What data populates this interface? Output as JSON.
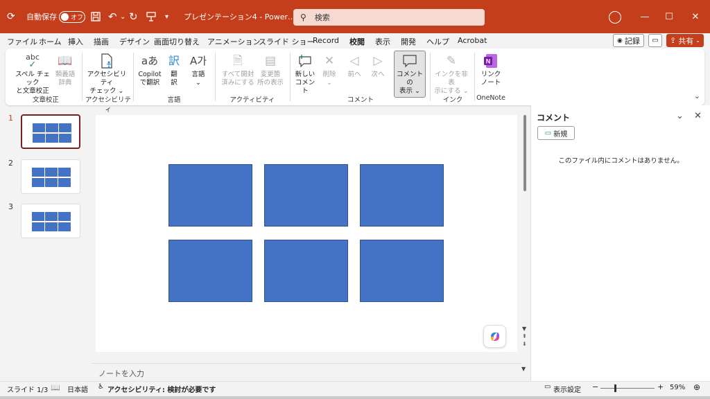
{
  "colors": {
    "brand": "#c43e1c",
    "shape_fill": "#4472c4",
    "shape_border": "#2f528f"
  },
  "titlebar": {
    "autosave_label": "自動保存",
    "autosave_state": "オフ",
    "doc_title": "プレゼンテーション4 - Power…",
    "search_placeholder": "検索",
    "icons": [
      "app-icon",
      "save-icon",
      "undo-icon",
      "redo-icon",
      "presenter-icon",
      "customize-icon",
      "user-icon"
    ],
    "window_controls": [
      "minimize",
      "maximize",
      "close"
    ]
  },
  "menu": {
    "tabs": [
      "ファイル",
      "ホーム",
      "挿入",
      "描画",
      "デザイン",
      "画面切り替え",
      "アニメーション",
      "スライド ショー",
      "Record",
      "校閲",
      "表示",
      "開発",
      "ヘルプ",
      "Acrobat"
    ],
    "active_tab": "校閲",
    "record_label": "記録",
    "share_label": "共有"
  },
  "ribbon": {
    "groups": [
      {
        "label": "文章校正",
        "buttons": [
          {
            "line1": "スペル チェック",
            "line2": "と文章校正"
          },
          {
            "line1": "類義語",
            "line2": "辞典"
          }
        ]
      },
      {
        "label": "アクセシビリティ",
        "buttons": [
          {
            "line1": "アクセシビリティ",
            "line2": "チェック ⌄"
          }
        ]
      },
      {
        "label": "言語",
        "buttons": [
          {
            "line1": "Copilot",
            "line2": "で翻訳"
          },
          {
            "line1": "翻",
            "line2": "訳"
          },
          {
            "line1": "言語",
            "line2": "⌄"
          }
        ]
      },
      {
        "label": "アクティビティ",
        "buttons": [
          {
            "line1": "すべて開封",
            "line2": "済みにする"
          },
          {
            "line1": "変更箇",
            "line2": "所の表示"
          }
        ]
      },
      {
        "label": "コメント",
        "buttons": [
          {
            "line1": "新しい",
            "line2": "コメント"
          },
          {
            "line1": "削除",
            "line2": "⌄"
          },
          {
            "line1": "前へ",
            "line2": ""
          },
          {
            "line1": "次へ",
            "line2": ""
          },
          {
            "line1": "コメントの",
            "line2": "表示 ⌄"
          }
        ]
      },
      {
        "label": "インク",
        "buttons": [
          {
            "line1": "インクを非表",
            "line2": "示にする ⌄"
          }
        ]
      },
      {
        "label": "OneNote",
        "buttons": [
          {
            "line1": "リンク",
            "line2": "ノート"
          }
        ]
      }
    ],
    "spell_icon_text": "abc",
    "lang_icon_text": "aあ",
    "lang2_icon_text": "A가"
  },
  "slides": {
    "items": [
      {
        "num": "1",
        "active": true
      },
      {
        "num": "2",
        "active": false
      },
      {
        "num": "3",
        "active": false
      }
    ]
  },
  "notes_placeholder": "ノートを入力",
  "comments": {
    "title": "コメント",
    "new_label": "新規",
    "empty_message": "このファイル内にコメントはありません。"
  },
  "status": {
    "slide_info": "スライド 1/3",
    "language": "日本語",
    "accessibility": "アクセシビリティ: 検討が必要です",
    "display_settings": "表示設定",
    "zoom": "59%",
    "zoom_minus": "−",
    "zoom_plus": "+"
  }
}
